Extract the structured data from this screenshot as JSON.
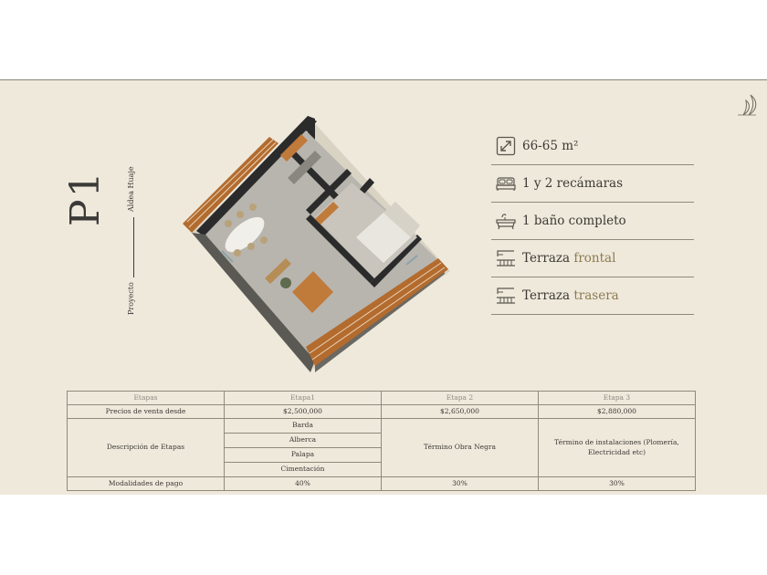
{
  "project": {
    "label": "Proyecto",
    "code": "P1",
    "name": "Aldea Huaje"
  },
  "features": [
    {
      "icon": "area-resize-icon",
      "text": "66-65 m²",
      "accent": ""
    },
    {
      "icon": "bed-icon",
      "text": "1 y 2 recámaras",
      "accent": ""
    },
    {
      "icon": "bathtub-icon",
      "text": "1  baño completo",
      "accent": ""
    },
    {
      "icon": "terrace-icon",
      "text": "Terraza ",
      "accent": "frontal"
    },
    {
      "icon": "terrace-icon",
      "text": "Terraza ",
      "accent": "trasera"
    }
  ],
  "table": {
    "headers": [
      "Etapas",
      "Etapa1",
      "Etapa 2",
      "Etapa 3"
    ],
    "prices": {
      "label": "Precios de venta desde",
      "values": [
        "$2,500,000",
        "$2,650,000",
        "$2,880,000"
      ]
    },
    "description": {
      "label": "Descripción de Etapas",
      "etapa1_items": [
        "Barda",
        "Alberca",
        "Palapa",
        "Cimentación"
      ],
      "etapa2": "Término Obra Negra",
      "etapa3": "Término de instalaciones (Plomería, Electricidad etc)"
    },
    "payment": {
      "label": "Modalidades de pago",
      "values": [
        "40%",
        "30%",
        "30%"
      ]
    }
  },
  "colors": {
    "background": "#efe9dc",
    "accent": "#8d7a52",
    "text": "#3c3a34",
    "rule": "#8f8a78"
  }
}
